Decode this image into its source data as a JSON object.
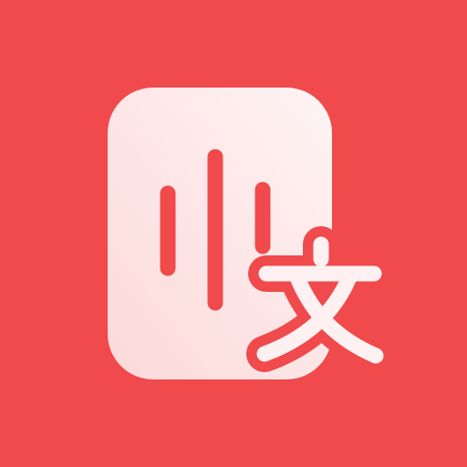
{
  "icon": {
    "name": "voice-to-text-app-icon",
    "glyph": "文",
    "background_color": "#F04A4C",
    "card_gradient_start": "#FCD9D9",
    "card_gradient_end": "#FFF4F4",
    "mark_color": "#F04A4C",
    "glyph_color": "#FFF1F1"
  }
}
